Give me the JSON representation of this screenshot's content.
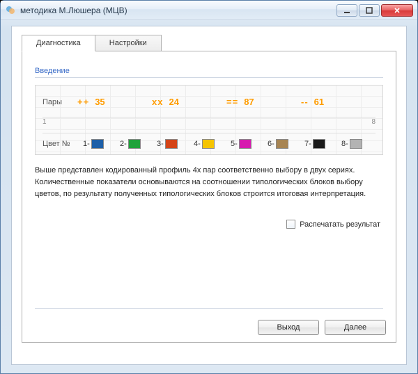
{
  "window": {
    "title": "методика М.Люшера (МЦВ)"
  },
  "tabs": {
    "diagnostics": "Диагностика",
    "settings": "Настройки"
  },
  "section": {
    "heading": "Введение"
  },
  "pairs": {
    "label": "Пары",
    "items": [
      {
        "symbol": "++",
        "value": "35"
      },
      {
        "symbol": "xx",
        "value": "24"
      },
      {
        "symbol": "==",
        "value": "87"
      },
      {
        "symbol": "--",
        "value": "61"
      }
    ],
    "axis_left": "1",
    "axis_right": "8"
  },
  "colors": {
    "label": "Цвет №",
    "items": [
      {
        "num": "1-",
        "hex": "#1d5fa8"
      },
      {
        "num": "2-",
        "hex": "#1fa23a"
      },
      {
        "num": "3-",
        "hex": "#d44417"
      },
      {
        "num": "4-",
        "hex": "#f5c400"
      },
      {
        "num": "5-",
        "hex": "#d61baf"
      },
      {
        "num": "6-",
        "hex": "#a78452"
      },
      {
        "num": "7-",
        "hex": "#1a1a1a"
      },
      {
        "num": "8-",
        "hex": "#b3b3b3"
      }
    ]
  },
  "description": "Выше представлен кодированный профиль 4х пар соответственно выбору в двух сериях. Количественные показатели основываются на соотношении типологических блоков выбору цветов, по результату полученных типологических блоков строится итоговая интерпретация.",
  "checkbox": {
    "label": "Распечатать результат"
  },
  "buttons": {
    "exit": "Выход",
    "next": "Далее"
  }
}
